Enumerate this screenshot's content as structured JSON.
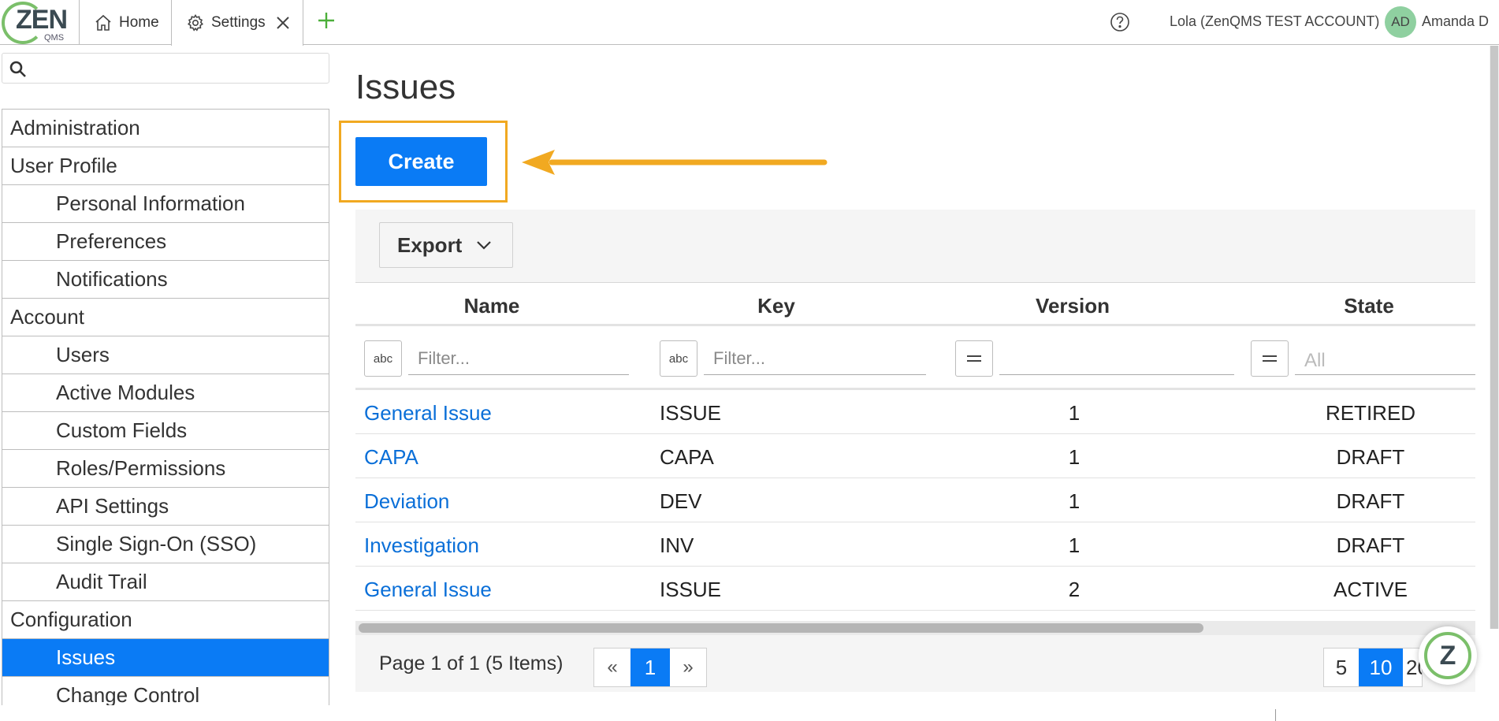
{
  "brand": {
    "logo_text": "ZEN",
    "logo_sub": "QMS"
  },
  "tabs": [
    {
      "label": "Home",
      "icon": "home-icon"
    },
    {
      "label": "Settings",
      "icon": "gear-icon"
    }
  ],
  "header": {
    "account": "Lola (ZenQMS TEST ACCOUNT)",
    "avatar_initials": "AD",
    "user": "Amanda D"
  },
  "search": {
    "placeholder": ""
  },
  "sidebar": {
    "items": [
      {
        "label": "Administration",
        "level": "section"
      },
      {
        "label": "User Profile",
        "level": "section"
      },
      {
        "label": "Personal Information",
        "level": "item"
      },
      {
        "label": "Preferences",
        "level": "item"
      },
      {
        "label": "Notifications",
        "level": "item"
      },
      {
        "label": "Account",
        "level": "section"
      },
      {
        "label": "Users",
        "level": "item"
      },
      {
        "label": "Active Modules",
        "level": "item"
      },
      {
        "label": "Custom Fields",
        "level": "item"
      },
      {
        "label": "Roles/Permissions",
        "level": "item"
      },
      {
        "label": "API Settings",
        "level": "item"
      },
      {
        "label": "Single Sign-On (SSO)",
        "level": "item"
      },
      {
        "label": "Audit Trail",
        "level": "item"
      },
      {
        "label": "Configuration",
        "level": "section"
      },
      {
        "label": "Issues",
        "level": "item",
        "active": true
      },
      {
        "label": "Change Control",
        "level": "item"
      }
    ]
  },
  "main": {
    "title": "Issues",
    "create_label": "Create",
    "export_label": "Export",
    "columns": [
      "Name",
      "Key",
      "Version",
      "State"
    ],
    "filters": {
      "name_placeholder": "Filter...",
      "key_placeholder": "Filter...",
      "state_value": "All",
      "text_icon": "abc"
    },
    "rows": [
      {
        "name": "General Issue",
        "key": "ISSUE",
        "version": "1",
        "state": "RETIRED"
      },
      {
        "name": "CAPA",
        "key": "CAPA",
        "version": "1",
        "state": "DRAFT"
      },
      {
        "name": "Deviation",
        "key": "DEV",
        "version": "1",
        "state": "DRAFT"
      },
      {
        "name": "Investigation",
        "key": "INV",
        "version": "1",
        "state": "DRAFT"
      },
      {
        "name": "General Issue",
        "key": "ISSUE",
        "version": "2",
        "state": "ACTIVE"
      }
    ],
    "pager": {
      "info": "Page 1 of 1 (5 Items)",
      "prev": "«",
      "current": "1",
      "next": "»",
      "sizes": [
        "5",
        "10",
        "20"
      ]
    }
  },
  "chat_badge": {
    "letter": "Z"
  },
  "colors": {
    "primary": "#0a7bf5",
    "highlight": "#f1a921",
    "link": "#0a6fd8",
    "brand_green": "#7bbf6a"
  }
}
